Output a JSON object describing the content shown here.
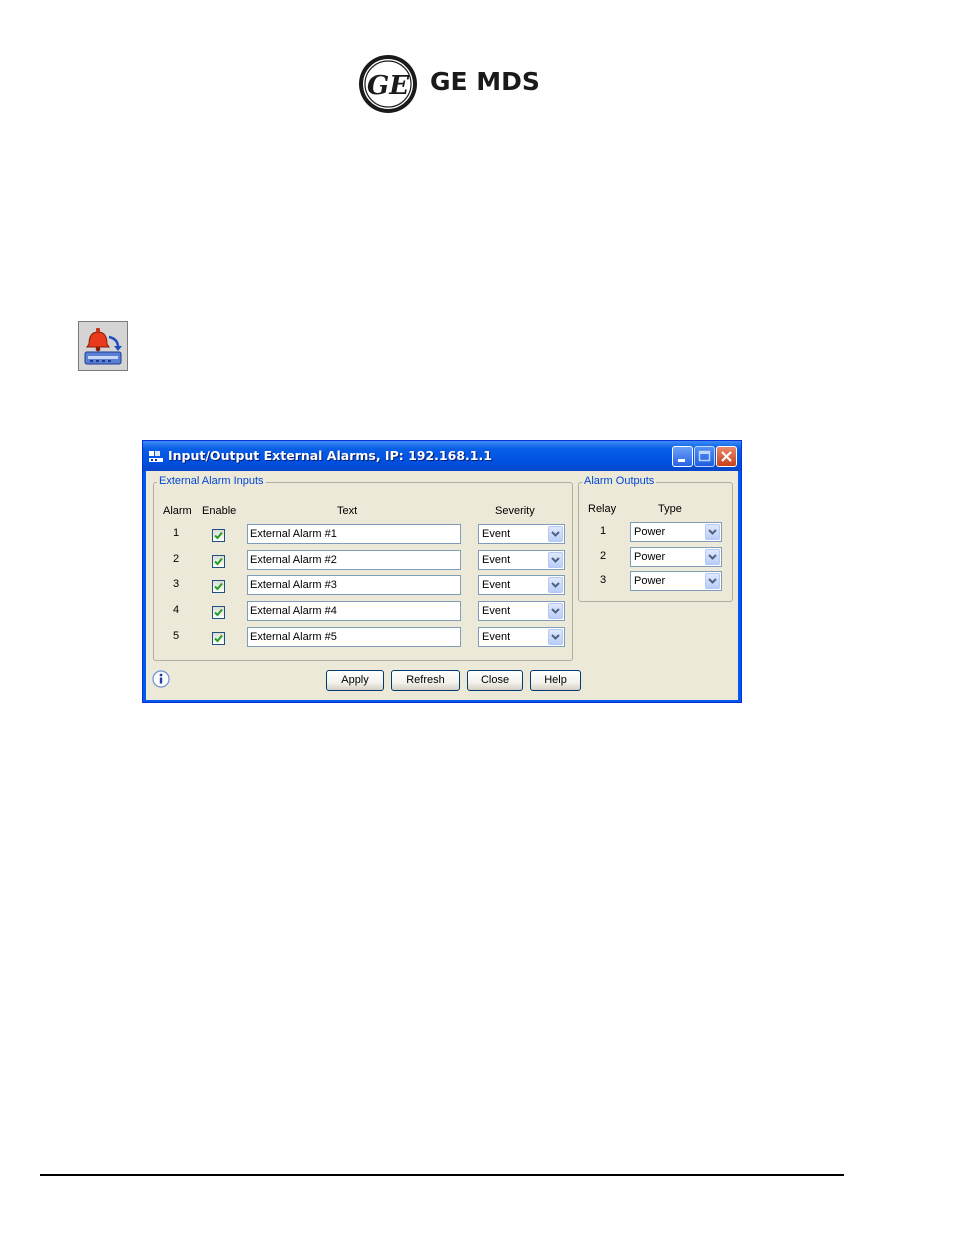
{
  "logo": {
    "brand": "GE MDS",
    "seal_text": "GE"
  },
  "dialog": {
    "title": "Input/Output External Alarms, IP: 192.168.1.1",
    "inputs": {
      "group_label": "External Alarm Inputs",
      "headers": {
        "alarm": "Alarm",
        "enable": "Enable",
        "text": "Text",
        "severity": "Severity"
      },
      "rows": [
        {
          "alarm": "1",
          "enabled": true,
          "text": "External Alarm #1",
          "severity": "Event"
        },
        {
          "alarm": "2",
          "enabled": true,
          "text": "External Alarm #2",
          "severity": "Event"
        },
        {
          "alarm": "3",
          "enabled": true,
          "text": "External Alarm #3",
          "severity": "Event"
        },
        {
          "alarm": "4",
          "enabled": true,
          "text": "External Alarm #4",
          "severity": "Event"
        },
        {
          "alarm": "5",
          "enabled": true,
          "text": "External Alarm #5",
          "severity": "Event"
        }
      ]
    },
    "outputs": {
      "group_label": "Alarm Outputs",
      "headers": {
        "relay": "Relay",
        "type": "Type"
      },
      "rows": [
        {
          "relay": "1",
          "type": "Power"
        },
        {
          "relay": "2",
          "type": "Power"
        },
        {
          "relay": "3",
          "type": "Power"
        }
      ]
    },
    "buttons": {
      "apply": "Apply",
      "refresh": "Refresh",
      "close": "Close",
      "help": "Help"
    }
  },
  "colors": {
    "titlebar": "#0a5fe8",
    "group_label": "#0046d5",
    "check": "#21a121",
    "dialog_bg": "#ece9d8"
  }
}
